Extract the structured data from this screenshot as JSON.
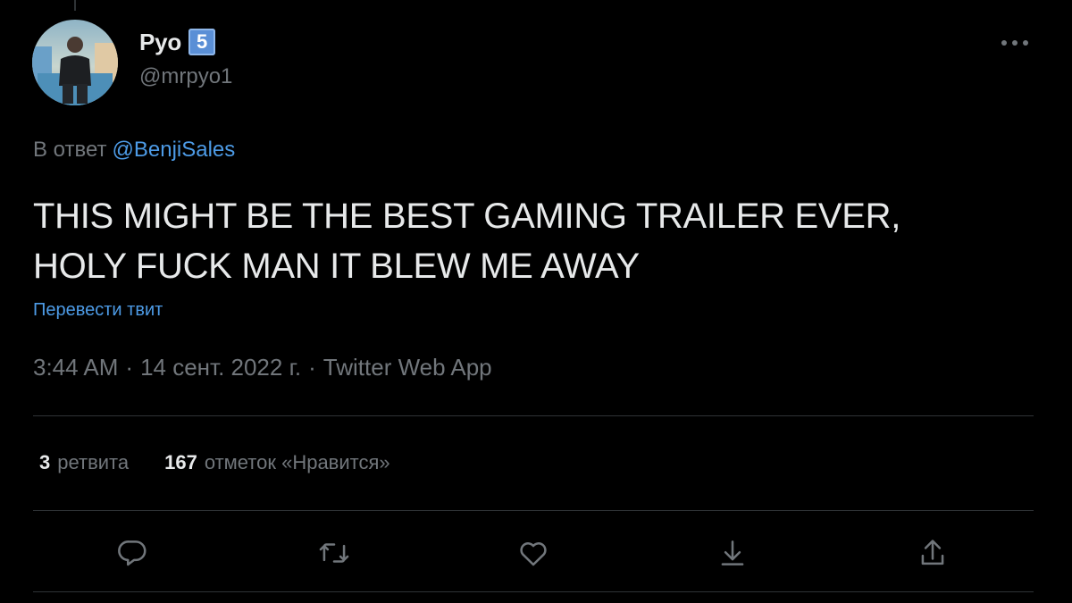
{
  "tweet": {
    "author": {
      "display_name": "Pyo",
      "badge": "5",
      "handle": "@mrpyo1"
    },
    "reply_to": {
      "prefix": "В ответ",
      "mention": "@BenjiSales"
    },
    "text_lines": [
      "THIS MIGHT BE THE BEST GAMING TRAILER EVER,",
      "HOLY FUCK MAN IT BLEW ME AWAY"
    ],
    "translate_label": "Перевести твит",
    "meta": {
      "time": "3:44 AM",
      "date": "14 сент. 2022 г.",
      "source": "Twitter Web App",
      "separator": "·"
    },
    "stats": {
      "retweets_count": "3",
      "retweets_label": "ретвита",
      "likes_count": "167",
      "likes_label": "отметок «Нравится»"
    },
    "actions": [
      "reply-icon",
      "retweet-icon",
      "like-icon",
      "bookmark-icon",
      "share-icon"
    ]
  },
  "colors": {
    "background": "#000000",
    "text_primary": "#e7e9ea",
    "text_secondary": "#71767b",
    "link": "#4d9be6",
    "divider": "#2f3336",
    "badge": "#5a8fd6"
  }
}
